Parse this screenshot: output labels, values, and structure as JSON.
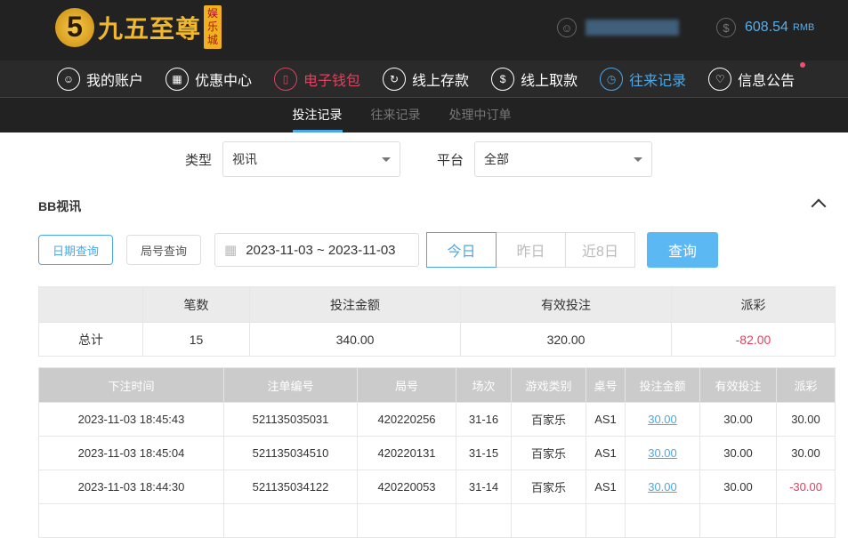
{
  "header": {
    "logo_text": "九五至尊",
    "logo_tag": "娱乐城",
    "logo_digit": "5",
    "balance": "608.54",
    "currency": "RMB"
  },
  "nav": [
    {
      "label": "我的账户"
    },
    {
      "label": "优惠中心"
    },
    {
      "label": "电子钱包"
    },
    {
      "label": "线上存款"
    },
    {
      "label": "线上取款"
    },
    {
      "label": "往来记录"
    },
    {
      "label": "信息公告"
    }
  ],
  "subtabs": [
    "投注记录",
    "往来记录",
    "处理中订单"
  ],
  "filters": {
    "type_label": "类型",
    "type_value": "视讯",
    "platform_label": "平台",
    "platform_value": "全部"
  },
  "section_title": "BB视讯",
  "query": {
    "date_query": "日期查询",
    "round_query": "局号查询",
    "date_range": "2023-11-03 ~ 2023-11-03",
    "today": "今日",
    "yesterday": "昨日",
    "last8": "近8日",
    "search": "查询"
  },
  "summary": {
    "headers": [
      "",
      "笔数",
      "投注金额",
      "有效投注",
      "派彩"
    ],
    "row": [
      "总计",
      "15",
      "340.00",
      "320.00",
      "-82.00"
    ]
  },
  "table": {
    "headers": [
      "下注时间",
      "注单编号",
      "局号",
      "场次",
      "游戏类别",
      "桌号",
      "投注金额",
      "有效投注",
      "派彩"
    ],
    "rows": [
      [
        "2023-11-03 18:45:43",
        "521135035031",
        "420220256",
        "31-16",
        "百家乐",
        "AS1",
        "30.00",
        "30.00",
        "30.00"
      ],
      [
        "2023-11-03 18:45:04",
        "521135034510",
        "420220131",
        "31-15",
        "百家乐",
        "AS1",
        "30.00",
        "30.00",
        "30.00"
      ],
      [
        "2023-11-03 18:44:30",
        "521135034122",
        "420220053",
        "31-14",
        "百家乐",
        "AS1",
        "30.00",
        "30.00",
        "-30.00"
      ],
      [
        "",
        "",
        "",
        "",
        "",
        "",
        "",
        "",
        ""
      ]
    ]
  }
}
